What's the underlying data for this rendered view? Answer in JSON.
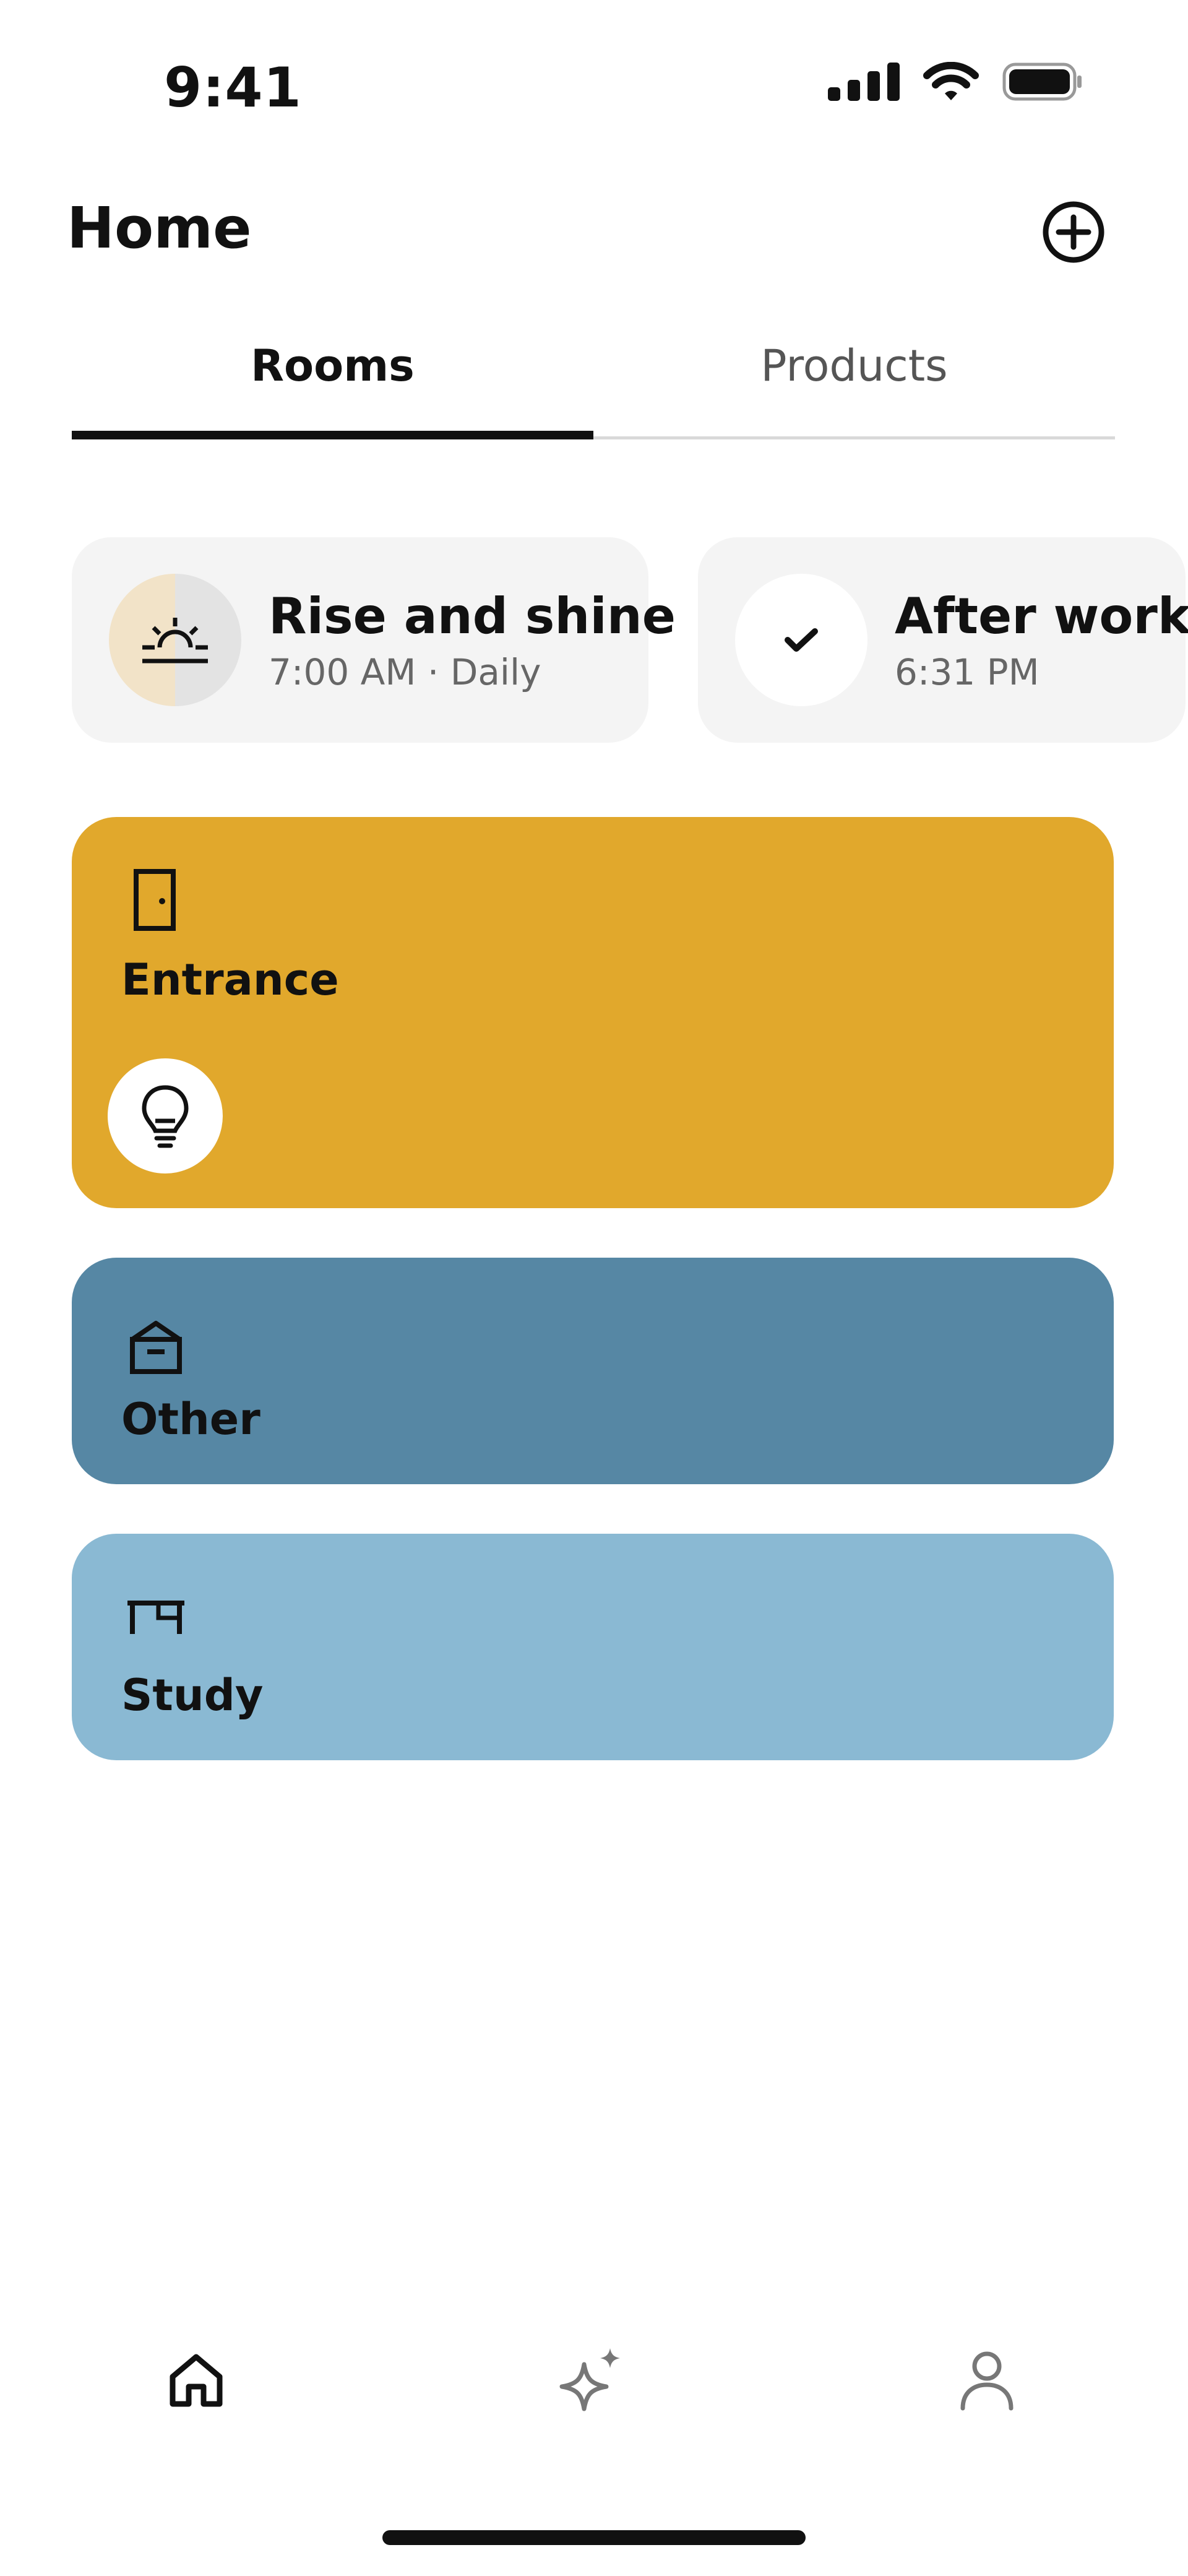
{
  "status_bar": {
    "time": "9:41"
  },
  "header": {
    "title": "Home"
  },
  "tabs": [
    {
      "label": "Rooms",
      "active": true
    },
    {
      "label": "Products",
      "active": false
    }
  ],
  "routines": [
    {
      "name": "Rise and shine",
      "meta": "7:00 AM · Daily",
      "icon": "sunrise-icon"
    },
    {
      "name": "After work",
      "meta": "6:31 PM",
      "icon": "checkmark-icon"
    }
  ],
  "rooms": [
    {
      "name": "Entrance",
      "icon": "door-icon",
      "color": "#e1a82c"
    },
    {
      "name": "Other",
      "icon": "box-icon",
      "color": "#5687a4"
    },
    {
      "name": "Study",
      "icon": "desk-icon",
      "color": "#8ab9d3"
    }
  ],
  "bottom_nav": [
    {
      "icon": "home-icon",
      "active": true
    },
    {
      "icon": "sparkle-icon",
      "active": false
    },
    {
      "icon": "profile-icon",
      "active": false
    }
  ]
}
